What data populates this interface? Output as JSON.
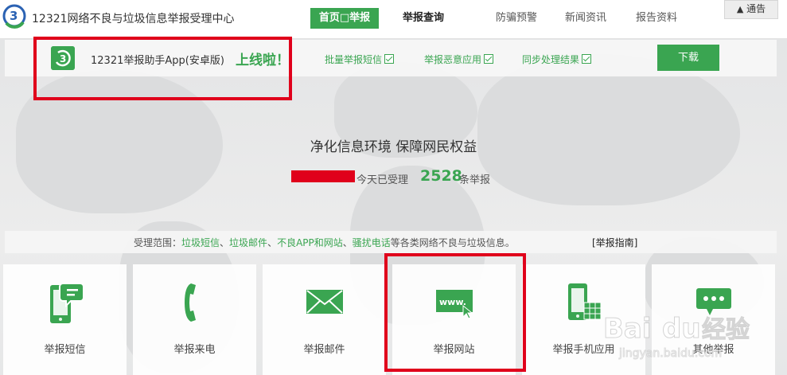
{
  "header": {
    "site_title": "12321网络不良与垃圾信息举报受理中心",
    "nav": {
      "home": "首页□举报",
      "query": "举报查询",
      "fraud": "防骗预警",
      "news": "新闻资讯",
      "report": "报告资料"
    },
    "notice": "通告"
  },
  "promo": {
    "text": "12321举报助手App(安卓版)",
    "highlight": "上线啦！",
    "features": [
      "批量举报短信",
      "举报恶意应用",
      "同步处理结果"
    ],
    "download_label": "下载"
  },
  "hero": {
    "slogan": "净化信息环境  保障网民权益",
    "today_prefix": "今天已受理",
    "today_count": "2528",
    "today_suffix": "条举报"
  },
  "scope": {
    "prefix": "受理范围：",
    "items": [
      "垃圾短信",
      "垃圾邮件",
      "不良APP和网站",
      "骚扰电话"
    ],
    "sep": "、",
    "suffix": "等各类网络不良与垃圾信息。",
    "guide": "[举报指南]"
  },
  "cards": [
    {
      "label": "举报短信",
      "icon": "sms-phone-icon"
    },
    {
      "label": "举报来电",
      "icon": "phone-handset-icon"
    },
    {
      "label": "举报邮件",
      "icon": "envelope-icon"
    },
    {
      "label": "举报网站",
      "icon": "www-icon"
    },
    {
      "label": "举报手机应用",
      "icon": "mobile-app-icon"
    },
    {
      "label": "其他举报",
      "icon": "chat-dots-icon"
    }
  ],
  "watermark": {
    "brand": "Baidu经验",
    "url": "jingyan.baidu.com"
  },
  "colors": {
    "accent": "#3aa551",
    "highlight_red": "#e0001b"
  }
}
